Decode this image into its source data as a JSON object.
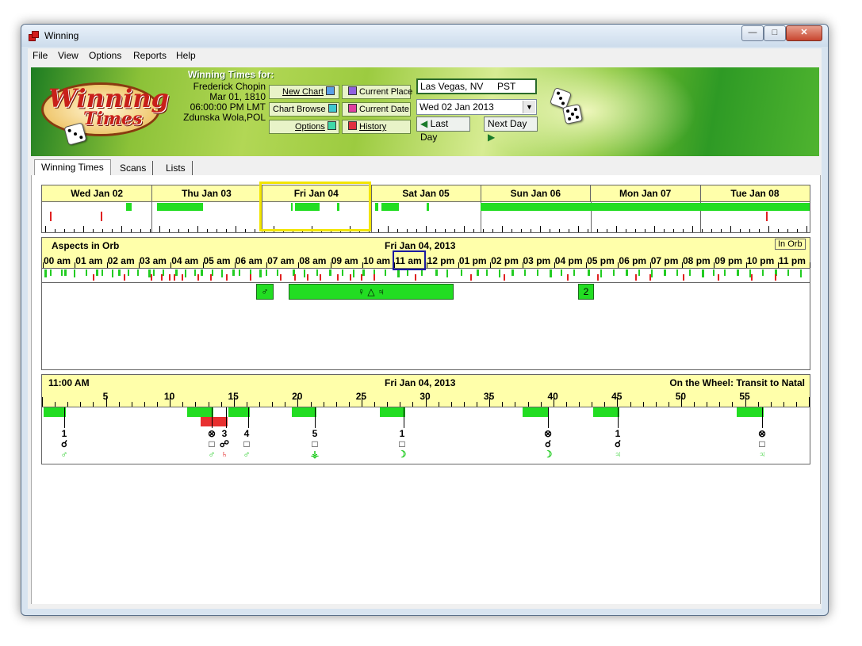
{
  "window": {
    "title": "Winning",
    "min": "—",
    "max": "□",
    "close": "✕"
  },
  "menu": [
    "File",
    "View",
    "Options",
    "Reports",
    "Help"
  ],
  "banner": {
    "logo_line1": "Winning",
    "logo_line2": "Times",
    "heading": "Winning Times for:",
    "chart": {
      "name": "Frederick Chopin",
      "date": "Mar 01, 1810",
      "time": "06:00:00 PM LMT",
      "place": "Zdunska Wola,POL"
    },
    "buttons": {
      "new_chart": "New Chart",
      "current_place": "Current Place",
      "chart_browse": "Chart Browse",
      "current_date": "Current Date",
      "options": "Options",
      "history": "History"
    },
    "location": "Las Vegas, NV",
    "timezone": "PST",
    "date_value": "Wed 02 Jan 2013",
    "last_day": "Last Day",
    "next_day": "Next Day"
  },
  "tabs": [
    "Winning Times",
    "Scans",
    "Lists"
  ],
  "days": [
    "Wed Jan 02",
    "Thu Jan 03",
    "Fri Jan 04",
    "Sat Jan 05",
    "Sun Jan 06",
    "Mon Jan 07",
    "Tue Jan 08"
  ],
  "aspects": {
    "title": "Aspects in Orb",
    "date": "Fri Jan 04, 2013",
    "badge": "In Orb",
    "hours": [
      "00",
      "am",
      "01",
      "am",
      "02",
      "am",
      "03",
      "am",
      "04",
      "am",
      "05",
      "am",
      "06",
      "am",
      "07",
      "am",
      "08",
      "am",
      "09",
      "am",
      "10",
      "am",
      "11",
      "am",
      "12",
      "pm",
      "01",
      "pm",
      "02",
      "pm",
      "03",
      "pm",
      "04",
      "pm",
      "05",
      "pm",
      "06",
      "pm",
      "07",
      "pm",
      "08",
      "pm",
      "09",
      "pm",
      "10",
      "pm",
      "11",
      "pm"
    ],
    "bars": [
      {
        "label": "♂"
      },
      {
        "label": "♀ △ ♃"
      },
      {
        "label": "2"
      }
    ]
  },
  "wheel": {
    "time": "11:00 AM",
    "date": "Fri Jan 04, 2013",
    "mode": "On the Wheel:  Transit to Natal",
    "scale_labels": [
      "5",
      "10",
      "15",
      "20",
      "25",
      "30",
      "35",
      "40",
      "45",
      "50",
      "55"
    ],
    "columns": [
      {
        "top": "1",
        "mid": "☌",
        "bot": "♂"
      },
      {
        "top": "⊗",
        "mid": "□",
        "bot": "♂"
      },
      {
        "top": "3",
        "mid": "☍",
        "bot": "♄"
      },
      {
        "top": "4",
        "mid": "□",
        "bot": "♂"
      },
      {
        "top": "5",
        "mid": "□",
        "bot": "⚶"
      },
      {
        "top": "1",
        "mid": "□",
        "bot": "☽"
      },
      {
        "top": "⊗",
        "mid": "☌",
        "bot": "☽"
      },
      {
        "top": "1",
        "mid": "☌",
        "bot": "♃"
      },
      {
        "top": "⊗",
        "mid": "□",
        "bot": "♃"
      }
    ]
  }
}
